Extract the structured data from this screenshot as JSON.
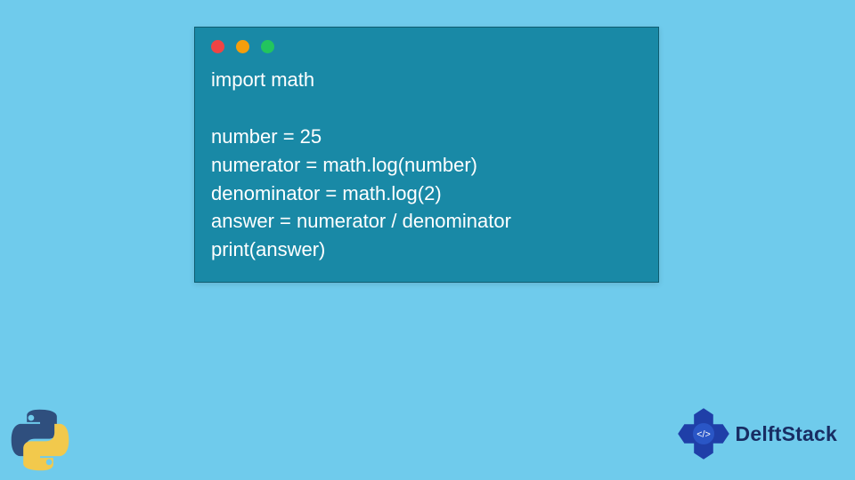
{
  "code": {
    "lines": [
      "import math",
      "",
      "number = 25",
      "numerator = math.log(number)",
      "denominator = math.log(2)",
      "answer = numerator / denominator",
      "print(answer)"
    ]
  },
  "traffic_lights": [
    "red",
    "amber",
    "green"
  ],
  "brand": {
    "name": "DelftStack"
  },
  "colors": {
    "page_bg": "#6fcbec",
    "window_bg": "#1989a6",
    "brand_text": "#182d63"
  }
}
